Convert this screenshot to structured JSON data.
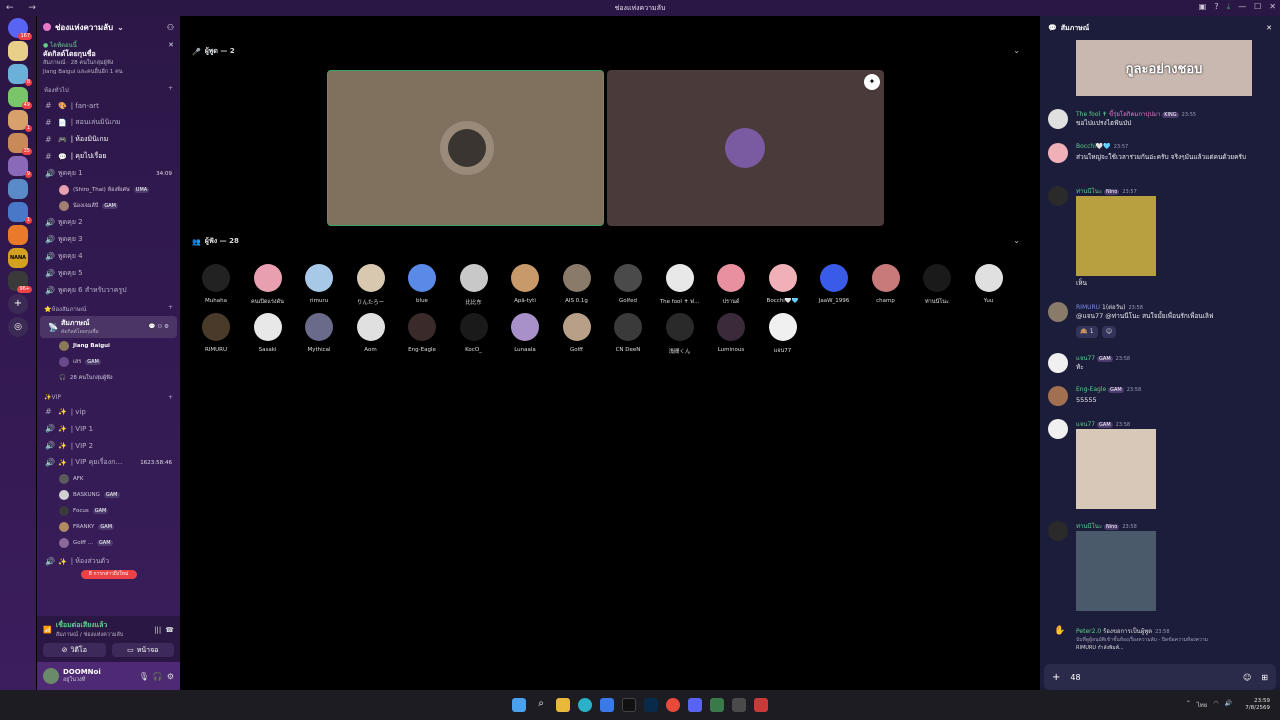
{
  "window": {
    "title": "ช่องแห่งความลับ"
  },
  "server": {
    "name": "ช่องแห่งความลับ"
  },
  "event": {
    "status": "ไลฟ์ตอนนี้",
    "title": "คัดกิลด์โดยกุนชื่อ",
    "meta": "สัมภาษณ์ · 28 คนในกลุ่มผู้ฟัง",
    "meta2": "Jiang Baigui และคนอื่นอีก 1 คน"
  },
  "sidebar": {
    "cat_general": "ห้องทั่วไป",
    "text_channels": [
      {
        "label": "| fan-art"
      },
      {
        "label": "| สอนเล่นมินิเกม"
      },
      {
        "label": "| ห้องมินิเกม"
      },
      {
        "label": "| คุยไปเรื่อย"
      }
    ],
    "voice1": {
      "label": "พูดคุย 1",
      "timer": "34:09"
    },
    "voice1_users": [
      {
        "name": "(Shiro_Thai) ห้องพิเศษ",
        "tag": "UMA"
      },
      {
        "name": "น้องเจมส์บี",
        "tag": "GAM"
      }
    ],
    "voice_channels": [
      "พูดคุย 2",
      "พูดคุย 3",
      "พูดคุย 4",
      "พูดคุย 5",
      "พูดคุย 6 สำหรับวาครูป"
    ],
    "cat_interview": "ห้องสัมภาษณ์",
    "interview": {
      "label": "สัมภาษณ์",
      "sub": "คัดกิลด์โดยกุนชื่อ"
    },
    "interview_users": [
      {
        "name": "Jiang Baigui"
      },
      {
        "name": "เสร",
        "tag": "GAM"
      }
    ],
    "interview_listeners": "28 คนในกลุ่มผู้ฟัง",
    "cat_vip": "VIP",
    "vip_channels": [
      "| vip",
      "| VIP 1",
      "| VIP 2"
    ],
    "vip_voice": {
      "label": "| VIP คุยเรื่องก…",
      "timer": "1623:58:46"
    },
    "vip_users": [
      {
        "name": "AFK"
      },
      {
        "name": "BASKUNG",
        "tag": "GAM"
      },
      {
        "name": "Focus",
        "tag": "GAM"
      },
      {
        "name": "FRANKY",
        "tag": "GAM"
      },
      {
        "name": "Golff ...",
        "tag": "GAM"
      }
    ],
    "private": "| ห้องส่วนตัว",
    "unread_pill": "8 การกล่าวถึงใหม่"
  },
  "voice": {
    "connected": "เชื่อมต่อเสียงแล้ว",
    "channel": "สัมภาษณ์ / ช่องแห่งความลับ",
    "video_btn": "วิดีโอ",
    "screen_btn": "หน้าจอ"
  },
  "user": {
    "name": "DOOMNoi",
    "status": "อยู่ในวงที"
  },
  "stage": {
    "speakers_label": "ผู้พูด — 2",
    "listeners_label": "ผู้ฟัง — 28",
    "listeners_row1": [
      "Muhaha",
      "คนเปิดแรงดัน",
      "rimuru",
      "りんたろー",
      "blue",
      "比比东",
      "Apā-tyti",
      "AIS 0.1g",
      "Golfed",
      "The fool ✝ ฟ...",
      "ปรานด์",
      "Bocchi🤍🩵",
      "JaaW_1996",
      "champ",
      "ท่านนีโนะ",
      "Yuu"
    ],
    "listeners_row2": [
      "RIMURU",
      "Sasaki",
      "Mythical",
      "Aom",
      "Eng-Eagle",
      "KocO_",
      "Lunaala",
      "Golff",
      "CN DeeN",
      "浅間くん",
      "Luminous",
      "แจน77"
    ]
  },
  "chat": {
    "title": "สัมภาษณ์",
    "banner": "กูละอย่างชอบ",
    "messages": [
      {
        "user": "The fool ✝",
        "extra": "ขี้รุ่ยโลกิคมกาปุปมา",
        "tag": "KING",
        "time": "23:55",
        "text": "ขอไปแปรงไฮฟันป่ป"
      },
      {
        "user": "Bocchi🤍🩵",
        "time": "23:57",
        "text": "ส่วนใหญ่จะใช้เวลาร่วมกันอ่ะครับ จริงๆมันแล้วแต่คนด้วยครับ"
      },
      {
        "user": "ท่านนีโนะ",
        "tag": "Nino",
        "time": "23:57",
        "text": ""
      },
      {
        "user": "",
        "time": "",
        "text": "เห็น"
      },
      {
        "user": "RIMURU",
        "extra": "1(ต่อวัน)",
        "time": "23:58",
        "text": "@แจน77 @ท่านนีโนะ สนใจมั้ยเพื่อนรักเพื่อนเลิฟ"
      },
      {
        "user": "แจน77",
        "tag": "GAM",
        "time": "23:58",
        "text": "ทัะ"
      },
      {
        "user": "Eng-Eagle",
        "tag": "GAM",
        "time": "23:58",
        "text": "55555"
      },
      {
        "user": "แจน77",
        "tag": "GAM",
        "time": "23:58",
        "text": ""
      },
      {
        "user": "ท่านนีโนะ",
        "tag": "Nino",
        "time": "23:58",
        "text": ""
      }
    ],
    "reaction_count": "1",
    "request": {
      "user": "Peter2.0",
      "text": "ร้องขอการเป็นผู้พูด",
      "time": "23:58",
      "sub": "นับที่ดูผู้อนุมัติเข้าชั้นห้องเรื่องความลับ - ปิดข้อความห้องความ",
      "sub2": "RIMURU กำลังพิมพ์..."
    },
    "input_value": "48"
  },
  "taskbar": {
    "time": "23:59",
    "date": "7/8/2569",
    "lang": "ไทย"
  },
  "colors": {
    "accent": "#5865f2",
    "green": "#5fcf8a",
    "sidebar": "#2c1748"
  }
}
